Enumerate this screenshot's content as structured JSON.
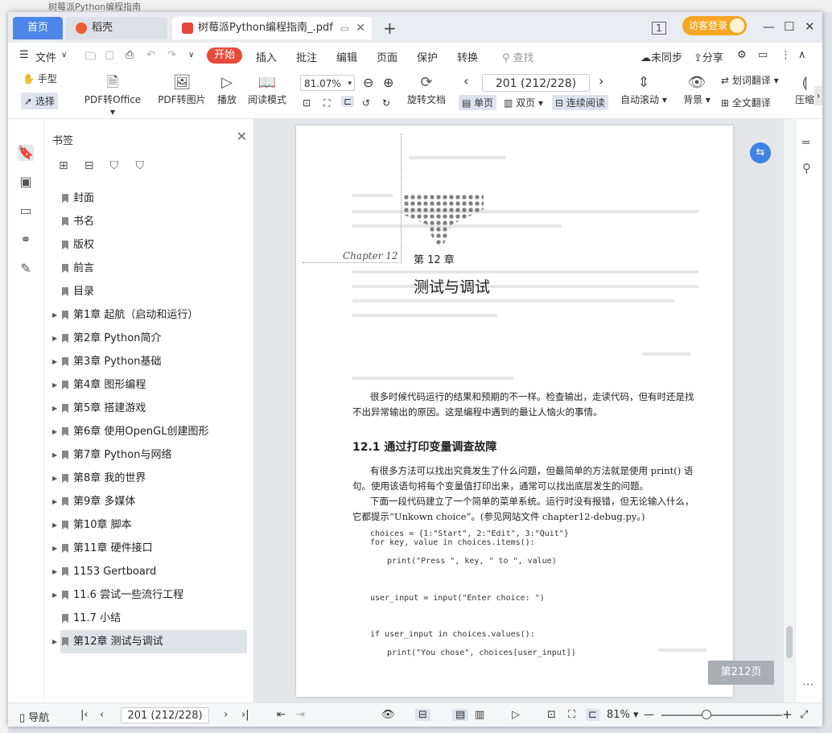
{
  "desktop": {
    "title_fragment": "树莓派Python编程指南"
  },
  "tabs": {
    "home": "首页",
    "daoke": "稻壳",
    "pdf": "树莓派Python编程指南_.pdf",
    "add": "+"
  },
  "titlebar": {
    "login": "访客登录"
  },
  "menu": {
    "file": "文件",
    "items": [
      "开始",
      "插入",
      "批注",
      "编辑",
      "页面",
      "保护",
      "转换"
    ],
    "search": "查找",
    "sync": "未同步",
    "share": "分享"
  },
  "ribbon": {
    "hand": "手型",
    "select": "选择",
    "pdf2office": "PDF转Office",
    "pdf2img": "PDF转图片",
    "play": "播放",
    "read_mode": "阅读模式",
    "zoom": "81.07%",
    "rotate": "旋转文档",
    "page_indicator": "201 (212/228)",
    "single": "单页",
    "double": "双页",
    "continuous": "连续阅读",
    "autoscroll": "自动滚动",
    "background": "背景",
    "word_translate": "划词翻译",
    "full_translate": "全文翻译",
    "compress": "压缩"
  },
  "bookmarks": {
    "header": "书签",
    "items": [
      {
        "label": "封面",
        "expandable": false
      },
      {
        "label": "书名",
        "expandable": false
      },
      {
        "label": "版权",
        "expandable": false
      },
      {
        "label": "前言",
        "expandable": false
      },
      {
        "label": "目录",
        "expandable": false
      },
      {
        "label": "第1章 起航（启动和运行）",
        "expandable": true
      },
      {
        "label": "第2章 Python简介",
        "expandable": true
      },
      {
        "label": "第3章 Python基础",
        "expandable": true
      },
      {
        "label": "第4章 图形编程",
        "expandable": true
      },
      {
        "label": "第5章 搭建游戏",
        "expandable": true
      },
      {
        "label": "第6章 使用OpenGL创建图形",
        "expandable": true
      },
      {
        "label": "第7章 Python与网络",
        "expandable": true
      },
      {
        "label": "第8章 我的世界",
        "expandable": true
      },
      {
        "label": "第9章 多媒体",
        "expandable": true
      },
      {
        "label": "第10章 脚本",
        "expandable": true
      },
      {
        "label": "第11章 硬件接口",
        "expandable": true
      },
      {
        "label": "1153 Gertboard",
        "expandable": true
      },
      {
        "label": "11.6 尝试一些流行工程",
        "expandable": true
      },
      {
        "label": "11.7 小结",
        "expandable": false
      },
      {
        "label": "第12章 测试与调试",
        "expandable": true,
        "active": true
      }
    ]
  },
  "page": {
    "chapter_sig": "Chapter 12",
    "chapter_num": "第 12 章",
    "chapter_title": "测试与调试",
    "intro": "很多时候代码运行的结果和预期的不一样。检查输出，走读代码，但有时还是找不出异常输出的原因。这是编程中遇到的最让人恼火的事情。",
    "section": "12.1   通过打印变量调查故障",
    "p1": "有很多方法可以找出究竟发生了什么问题，但最简单的方法就是使用 print() 语句。使用该语句将每个变量值打印出来，通常可以找出底层发生的问题。",
    "p2": "下面一段代码建立了一个简单的菜单系统。运行时没有报错，但无论输入什么，它都提示“Unkown choice”。(参见网站文件 chapter12-debug.py。)",
    "code1": "choices = {1:\"Start\", 2:\"Edit\", 3:\"Quit\"}\nfor key, value in choices.items():",
    "code2": "print(\"Press \", key, \" to \", value)",
    "code3": "user_input = input(\"Enter choice: \")",
    "code4": "if user_input in choices.values():",
    "code5": "print(\"You chose\", choices[user_input])",
    "badge": "第212页"
  },
  "status": {
    "nav": "导航",
    "page": "201 (212/228)",
    "zoom": "81%"
  }
}
